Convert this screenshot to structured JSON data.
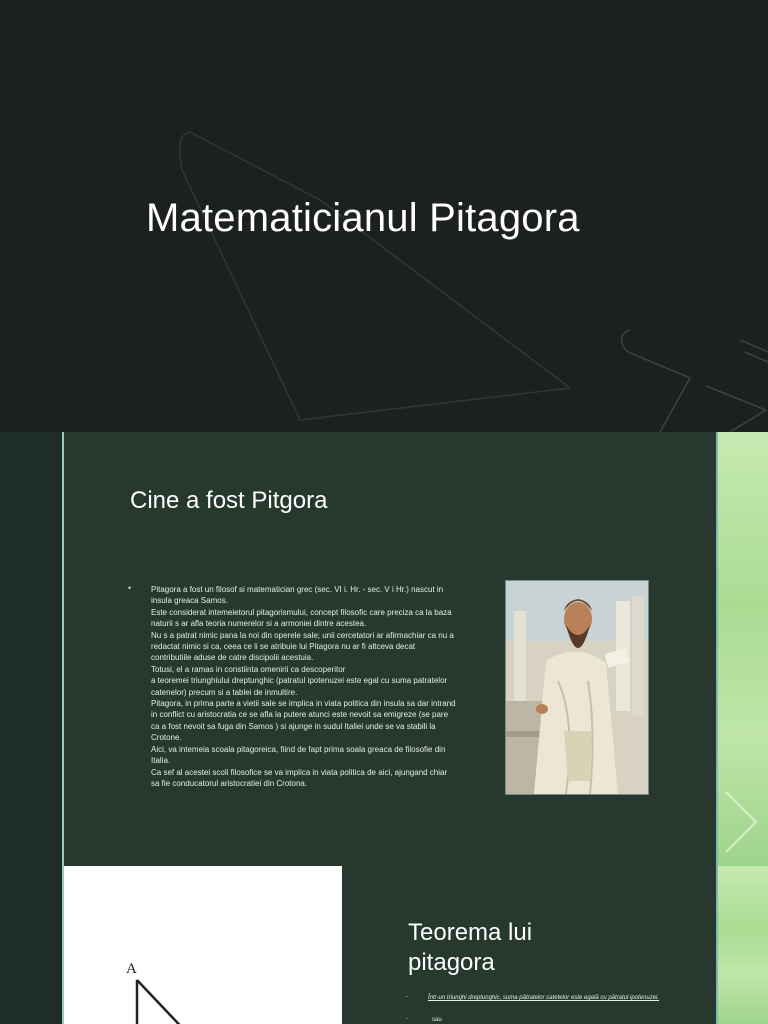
{
  "slide1": {
    "title": "Matematicianul Pitagora"
  },
  "slide2": {
    "heading": "Cine a fost Pitgora",
    "bullet_symbol": "•",
    "bio_text": "Pitagora a fost un filosof si matematician grec (sec. VI i. Hr. - sec. V i Hr.) nascut in insula greaca  Samos.\n Este considerat intemeietorul pitagorismului, concept filosofic care preciza ca la baza naturii s ar afla  teoria numerelor si a armoniei dintre acestea.\nNu s a patrat nimic pana la noi din operele sale; unii cercetatori ar afirmachiar ca nu a redactat nimic si ca, ceea ce li se atribuie lui Pitagora nu ar fi altceva decat contributiile aduse de catre discipolii acestuia.\n Totusi, el a ramas in constiinta omenirii ca descoperitor\na teoremei triunghiului dreptunghic (patratul ipotenuzei este egal cu suma patratelor catenelor) precum si a tablei de inmultire.\n Pitagora, in prima parte a vietii sale se implica in viata politica din insula sa dar intrand in conflict cu aristocratia ce se afla la putere atunci este nevoit sa emigreze (se pare ca a fost nevoit sa fuga din Samos ) si ajunge in sudul Italiei unde se  va stabili la Crotone.\n Aici, va intemeia scoala pitagoreica, fiind   de fapt prima soala greaca de filosofie din Italia.\nCa sef al acestei scoli filosofice se va implica in viata politica de aici, ajungand chiar sa fie conducatorul aristocratiei din Crotona.",
    "portrait_icon": "philosopher-portrait"
  },
  "slide3": {
    "heading": "Teorema lui pitagora",
    "bullet_symbol": "-",
    "theorem_text": "Într-un triunghi dreptunghic, suma pătratelor catetelor este egală cu pătratul ipotenuzei.",
    "small_text": "sau",
    "diagram_label_a": "A"
  },
  "colors": {
    "slide1_bg": "#1c201f",
    "slide2_bg": "#27382f",
    "accent_line": "#9ec6c0",
    "green_panel": "#a9dc93"
  }
}
